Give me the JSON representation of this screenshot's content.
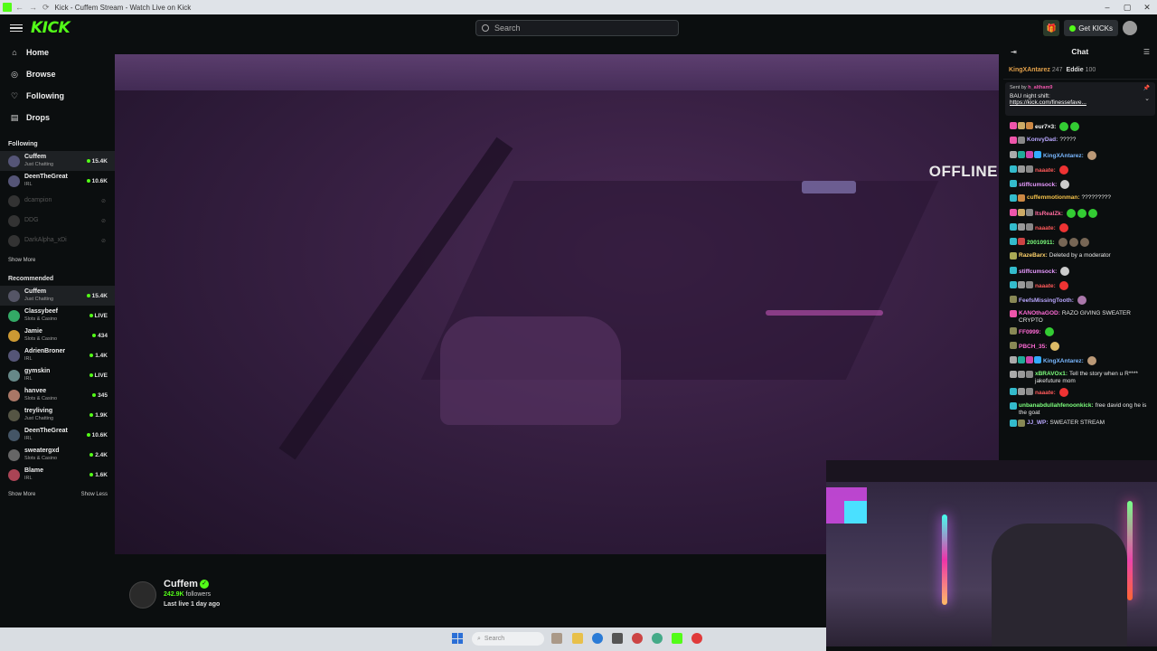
{
  "browser": {
    "tab_title": "Kick - Cuffem Stream - Watch Live on Kick",
    "back_glyph": "←",
    "forward_glyph": "→",
    "reload_glyph": "⟳",
    "min_glyph": "–",
    "max_glyph": "▢",
    "close_glyph": "✕"
  },
  "topnav": {
    "logo": "KICK",
    "search_placeholder": "Search",
    "get_kicks_label": "Get KICKs",
    "gift_icon": "gift-icon"
  },
  "sidebar": {
    "nav": [
      {
        "label": "Home",
        "icon": "⌂"
      },
      {
        "label": "Browse",
        "icon": "◎"
      },
      {
        "label": "Following",
        "icon": "♡"
      },
      {
        "label": "Drops",
        "icon": "▤"
      }
    ],
    "following_title": "Following",
    "following": [
      {
        "name": "Cuffem",
        "category": "Just Chatting",
        "viewers": "15.4K",
        "live": true,
        "active": true
      },
      {
        "name": "DeenTheGreat",
        "category": "IRL",
        "viewers": "10.6K",
        "live": true
      },
      {
        "name": "dcampion",
        "category": "",
        "viewers": "",
        "live": false
      },
      {
        "name": "DDG",
        "category": "",
        "viewers": "",
        "live": false
      },
      {
        "name": "DarkAlpha_xDi",
        "category": "",
        "viewers": "",
        "live": false
      }
    ],
    "following_show_more": "Show More",
    "recommended_title": "Recommended",
    "recommended": [
      {
        "name": "Cuffem",
        "category": "Just Chatting",
        "viewers": "15.4K",
        "active": true,
        "color": "#556"
      },
      {
        "name": "Classybeef",
        "category": "Slots & Casino",
        "viewers": "LIVE",
        "color": "#3a6"
      },
      {
        "name": "Jamie",
        "category": "Slots & Casino",
        "viewers": "434",
        "color": "#c93"
      },
      {
        "name": "AdrienBroner",
        "category": "IRL",
        "viewers": "1.4K",
        "color": "#557"
      },
      {
        "name": "gymskin",
        "category": "IRL",
        "viewers": "LIVE",
        "color": "#688"
      },
      {
        "name": "hanvee",
        "category": "Slots & Casino",
        "viewers": "345",
        "color": "#a76"
      },
      {
        "name": "treyliving",
        "category": "Just Chatting",
        "viewers": "1.9K",
        "color": "#554"
      },
      {
        "name": "DeenTheGreat",
        "category": "IRL",
        "viewers": "10.6K",
        "color": "#456"
      },
      {
        "name": "sweatergxd",
        "category": "Slots & Casino",
        "viewers": "2.4K",
        "color": "#666"
      },
      {
        "name": "Blame",
        "category": "IRL",
        "viewers": "1.6K",
        "color": "#a45"
      }
    ],
    "recommended_show_more": "Show More",
    "recommended_show_less": "Show Less"
  },
  "video": {
    "status": "OFFLINE"
  },
  "channel": {
    "name": "Cuffem",
    "followers_count": "242.9K",
    "followers_label": "followers",
    "last_live": "Last live 1 day ago"
  },
  "chat": {
    "title": "Chat",
    "gifters": [
      {
        "name": "KingXAntarez",
        "count": "247"
      },
      {
        "name": "Eddie",
        "count": "100"
      }
    ],
    "pinned": {
      "sent_by_prefix": "Sent by",
      "sent_by_user": "h_altham9",
      "text": "BAU night shift:",
      "link": "https://kick.com/finessefave..."
    },
    "messages": [
      {
        "user": "eur7×3:",
        "text": "",
        "color": "#ffffff",
        "badges": [
          "#e5a",
          "#ca6",
          "#c84"
        ],
        "emotes": [
          "#3c3",
          "#3c3"
        ]
      },
      {
        "user": "KonvyDad:",
        "text": "?????",
        "color": "#b9a7ff",
        "badges": [
          "#e5a",
          "#888"
        ],
        "emotes": []
      },
      {
        "user": "KingXAntarez:",
        "text": "",
        "color": "#7ab8ff",
        "badges": [
          "#aaa",
          "#2a9",
          "#c4a",
          "#3af"
        ],
        "emotes": [
          "#b97"
        ]
      },
      {
        "user": "naaate:",
        "text": "",
        "color": "#ff5a5a",
        "badges": [
          "#3bc",
          "#999",
          "#888"
        ],
        "emotes": [
          "#e33"
        ]
      },
      {
        "user": "stiffcumsock:",
        "text": "",
        "color": "#e89aff",
        "badges": [
          "#3bc"
        ],
        "emotes": [
          "#ccc"
        ]
      },
      {
        "user": "cuffemmotionman:",
        "text": "?????????",
        "color": "#f5c24a",
        "badges": [
          "#3bc",
          "#c84"
        ],
        "emotes": []
      },
      {
        "user": "ItsRealZk:",
        "text": "",
        "color": "#ff6b9e",
        "badges": [
          "#e5a",
          "#ca6",
          "#888"
        ],
        "emotes": [
          "#3c3",
          "#3c3",
          "#3c3"
        ]
      },
      {
        "user": "naaate:",
        "text": "",
        "color": "#ff5a5a",
        "badges": [
          "#3bc",
          "#999",
          "#888"
        ],
        "emotes": [
          "#e33"
        ]
      },
      {
        "user": "20010911:",
        "text": "",
        "color": "#7dff7d",
        "badges": [
          "#3bc",
          "#c44"
        ],
        "emotes": [
          "#765",
          "#765",
          "#765"
        ]
      },
      {
        "user": "RazeBarx:",
        "text": "Deleted by a moderator",
        "color": "#ffd36b",
        "badges": [
          "#aa5"
        ],
        "emotes": []
      },
      {
        "user": "stiffcumsock:",
        "text": "",
        "color": "#e89aff",
        "badges": [
          "#3bc"
        ],
        "emotes": [
          "#ccc"
        ]
      },
      {
        "user": "naaate:",
        "text": "",
        "color": "#ff5a5a",
        "badges": [
          "#3bc",
          "#999",
          "#888"
        ],
        "emotes": [
          "#e33"
        ]
      },
      {
        "user": "FeefsMissingTooth:",
        "text": "",
        "color": "#b9a7ff",
        "badges": [
          "#885"
        ],
        "emotes": [
          "#a7a"
        ]
      },
      {
        "user": "KANOthaGOD:",
        "text": "RAZO GIVING SWEATER CRYPTO",
        "color": "#ff6bd6",
        "badges": [
          "#e5a"
        ],
        "emotes": []
      },
      {
        "user": "FF0999:",
        "text": "",
        "color": "#ff6bd6",
        "badges": [
          "#885"
        ],
        "emotes": [
          "#3c3"
        ]
      },
      {
        "user": "PBCH_35:",
        "text": "",
        "color": "#ff6bd6",
        "badges": [
          "#885"
        ],
        "emotes": [
          "#db6"
        ]
      },
      {
        "user": "KingXAntarez:",
        "text": "",
        "color": "#7ab8ff",
        "badges": [
          "#aaa",
          "#2a9",
          "#c4a",
          "#3af"
        ],
        "emotes": [
          "#b97"
        ]
      },
      {
        "user": "xBRAVOx1:",
        "text": "Tell the story when u R**** jakefuture mom",
        "color": "#7dff7d",
        "badges": [
          "#aaa",
          "#999",
          "#888"
        ],
        "emotes": []
      },
      {
        "user": "naaate:",
        "text": "",
        "color": "#ff5a5a",
        "badges": [
          "#3bc",
          "#999",
          "#888"
        ],
        "emotes": [
          "#e33"
        ]
      },
      {
        "user": "unbanabdullahfenoonkick:",
        "text": "free david ong he is the goat",
        "color": "#7dff7d",
        "badges": [
          "#3bc"
        ],
        "emotes": []
      },
      {
        "user": "JJ_WP:",
        "text": "SWEATER STREAM",
        "color": "#b9a7ff",
        "badges": [
          "#3bc",
          "#885"
        ],
        "emotes": []
      }
    ]
  },
  "taskbar": {
    "search_placeholder": "Search"
  }
}
